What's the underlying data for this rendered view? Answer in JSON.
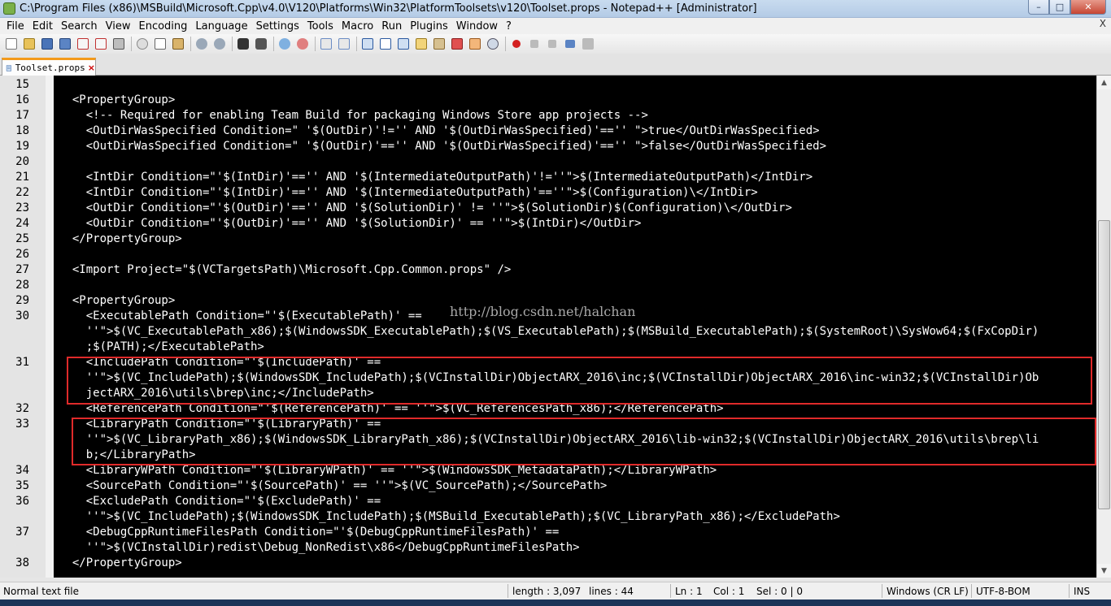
{
  "window": {
    "title": "C:\\Program Files (x86)\\MSBuild\\Microsoft.Cpp\\v4.0\\V120\\Platforms\\Win32\\PlatformToolsets\\v120\\Toolset.props - Notepad++ [Administrator]",
    "minimize_glyph": "–",
    "maximize_glyph": "□",
    "close_glyph": "✕"
  },
  "menu": {
    "items": [
      "File",
      "Edit",
      "Search",
      "View",
      "Encoding",
      "Language",
      "Settings",
      "Tools",
      "Macro",
      "Run",
      "Plugins",
      "Window",
      "?"
    ],
    "close_glyph": "X"
  },
  "toolbar": {
    "icons": [
      "new-file-icon",
      "open-file-icon",
      "save-icon",
      "save-all-icon",
      "close-icon",
      "close-all-icon",
      "print-icon",
      "cut-icon",
      "copy-icon",
      "paste-icon",
      "undo-icon",
      "redo-icon",
      "find-icon",
      "replace-icon",
      "zoom-in-icon",
      "zoom-out-icon",
      "sync-vertical-icon",
      "sync-horizontal-icon",
      "word-wrap-icon",
      "show-all-chars-icon",
      "indent-guide-icon",
      "user-language-icon",
      "document-map-icon",
      "function-list-icon",
      "folder-as-workspace-icon",
      "monitoring-icon",
      "record-macro-icon",
      "stop-record-icon",
      "play-macro-icon",
      "play-multiple-icon",
      "save-macro-icon"
    ]
  },
  "tabs": [
    {
      "label": "Toolset.props",
      "close_glyph": "×"
    }
  ],
  "editor": {
    "watermark": "http://blog.csdn.net/halchan",
    "lines": [
      {
        "num": "15",
        "text": ""
      },
      {
        "num": "16",
        "text": "  <PropertyGroup>"
      },
      {
        "num": "17",
        "text": "    <!-- Required for enabling Team Build for packaging Windows Store app projects -->"
      },
      {
        "num": "18",
        "text": "    <OutDirWasSpecified Condition=\" '$(OutDir)'!='' AND '$(OutDirWasSpecified)'=='' \">true</OutDirWasSpecified>"
      },
      {
        "num": "19",
        "text": "    <OutDirWasSpecified Condition=\" '$(OutDir)'=='' AND '$(OutDirWasSpecified)'=='' \">false</OutDirWasSpecified>"
      },
      {
        "num": "20",
        "text": ""
      },
      {
        "num": "21",
        "text": "    <IntDir Condition=\"'$(IntDir)'=='' AND '$(IntermediateOutputPath)'!=''\">$(IntermediateOutputPath)</IntDir>"
      },
      {
        "num": "22",
        "text": "    <IntDir Condition=\"'$(IntDir)'=='' AND '$(IntermediateOutputPath)'==''\">$(Configuration)\\</IntDir>"
      },
      {
        "num": "23",
        "text": "    <OutDir Condition=\"'$(OutDir)'=='' AND '$(SolutionDir)' != ''\">$(SolutionDir)$(Configuration)\\</OutDir>"
      },
      {
        "num": "24",
        "text": "    <OutDir Condition=\"'$(OutDir)'=='' AND '$(SolutionDir)' == ''\">$(IntDir)</OutDir>"
      },
      {
        "num": "25",
        "text": "  </PropertyGroup>"
      },
      {
        "num": "26",
        "text": ""
      },
      {
        "num": "27",
        "text": "  <Import Project=\"$(VCTargetsPath)\\Microsoft.Cpp.Common.props\" />"
      },
      {
        "num": "28",
        "text": ""
      },
      {
        "num": "29",
        "text": "  <PropertyGroup>"
      },
      {
        "num": "30",
        "text": "    <ExecutablePath Condition=\"'$(ExecutablePath)' =="
      },
      {
        "num": "",
        "text": "    ''\">$(VC_ExecutablePath_x86);$(WindowsSDK_ExecutablePath);$(VS_ExecutablePath);$(MSBuild_ExecutablePath);$(SystemRoot)\\SysWow64;$(FxCopDir)"
      },
      {
        "num": "",
        "text": "    ;$(PATH);</ExecutablePath>"
      },
      {
        "num": "31",
        "text": "    <IncludePath Condition=\"'$(IncludePath)' =="
      },
      {
        "num": "",
        "text": "    ''\">$(VC_IncludePath);$(WindowsSDK_IncludePath);$(VCInstallDir)ObjectARX_2016\\inc;$(VCInstallDir)ObjectARX_2016\\inc-win32;$(VCInstallDir)Ob"
      },
      {
        "num": "",
        "text": "    jectARX_2016\\utils\\brep\\inc;</IncludePath>"
      },
      {
        "num": "32",
        "text": "    <ReferencePath Condition=\"'$(ReferencePath)' == ''\">$(VC_ReferencesPath_x86);</ReferencePath>"
      },
      {
        "num": "33",
        "text": "    <LibraryPath Condition=\"'$(LibraryPath)' =="
      },
      {
        "num": "",
        "text": "    ''\">$(VC_LibraryPath_x86);$(WindowsSDK_LibraryPath_x86);$(VCInstallDir)ObjectARX_2016\\lib-win32;$(VCInstallDir)ObjectARX_2016\\utils\\brep\\li"
      },
      {
        "num": "",
        "text": "    b;</LibraryPath>"
      },
      {
        "num": "34",
        "text": "    <LibraryWPath Condition=\"'$(LibraryWPath)' == ''\">$(WindowsSDK_MetadataPath);</LibraryWPath>"
      },
      {
        "num": "35",
        "text": "    <SourcePath Condition=\"'$(SourcePath)' == ''\">$(VC_SourcePath);</SourcePath>"
      },
      {
        "num": "36",
        "text": "    <ExcludePath Condition=\"'$(ExcludePath)' =="
      },
      {
        "num": "",
        "text": "    ''\">$(VC_IncludePath);$(WindowsSDK_IncludePath);$(MSBuild_ExecutablePath);$(VC_LibraryPath_x86);</ExcludePath>"
      },
      {
        "num": "37",
        "text": "    <DebugCppRuntimeFilesPath Condition=\"'$(DebugCppRuntimeFilesPath)' =="
      },
      {
        "num": "",
        "text": "    ''\">$(VCInstallDir)redist\\Debug_NonRedist\\x86</DebugCppRuntimeFilesPath>"
      },
      {
        "num": "38",
        "text": "  </PropertyGroup>"
      }
    ]
  },
  "status": {
    "file_type": "Normal text file",
    "length": "length : 3,097",
    "lines": "lines : 44",
    "ln": "Ln : 1",
    "col": "Col : 1",
    "sel": "Sel : 0 | 0",
    "eol": "Windows (CR LF)",
    "encoding": "UTF-8-BOM",
    "mode": "INS"
  },
  "colors": {
    "editor_bg": "#000000",
    "text": "#ffffff",
    "highlight_box": "#e02a2a",
    "active_tab_accent": "#f39a1b"
  }
}
